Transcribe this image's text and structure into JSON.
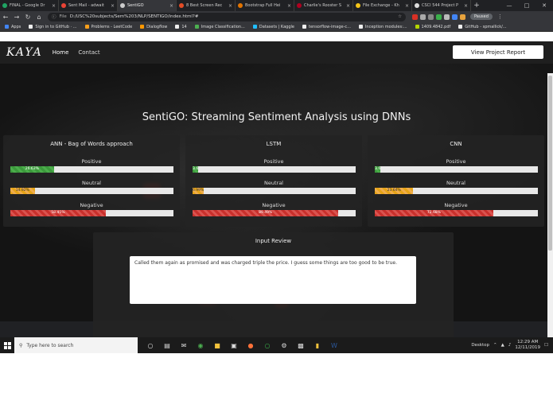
{
  "browser": {
    "tabs": [
      {
        "title": "FINAL - Google Dr",
        "color": "#1fa463"
      },
      {
        "title": "Sent Mail - adwait",
        "color": "#ea4335"
      },
      {
        "title": "SentiGO",
        "color": "#cccccc",
        "active": true
      },
      {
        "title": "8 Best Screen Rec",
        "color": "#e34c26"
      },
      {
        "title": "Bootstrap Full Hei",
        "color": "#e37400"
      },
      {
        "title": "Charlie's Rooster S",
        "color": "#b00020"
      },
      {
        "title": "File Exchange - Kh",
        "color": "#f5c518"
      },
      {
        "title": "CSCI 544 Project P",
        "color": "#dddddd"
      }
    ],
    "url": "D:/USC%20subjects/Sem%203/NLP/SENTIGO/index.html?#",
    "url_prefix": "File",
    "profile_label": "Paused",
    "bookmarks": [
      {
        "label": "Apps",
        "color": "#4285f4"
      },
      {
        "label": "Sign in to GitHub · ...",
        "color": "#eeeeee"
      },
      {
        "label": "Problems - LeetCode",
        "color": "#f89f1b"
      },
      {
        "label": "Dialogflow",
        "color": "#ff9800"
      },
      {
        "label": "14",
        "color": "#eeeeee"
      },
      {
        "label": "Image Classification...",
        "color": "#4caf50"
      },
      {
        "label": "Datasets | Kaggle",
        "color": "#20beff"
      },
      {
        "label": "tensorflow-image-c...",
        "color": "#eeeeee"
      },
      {
        "label": "Inception modules:...",
        "color": "#eeeeee"
      },
      {
        "label": "1409.4842.pdf",
        "color": "#b3d400"
      },
      {
        "label": "GitHub - spmallick/...",
        "color": "#eeeeee"
      }
    ]
  },
  "navbar": {
    "brand": "KAYA",
    "links": [
      "Home",
      "Contact"
    ],
    "report_button": "View Project Report"
  },
  "page_title": "SentiGO: Streaming Sentiment Analysis using DNNs",
  "models": [
    {
      "title": "ANN - Bag of Words approach",
      "bars": [
        {
          "label": "Positive",
          "value": 26.63,
          "text": "26.63%",
          "kind": "green"
        },
        {
          "label": "Neutral",
          "value": 14.92,
          "text": "14.92%",
          "kind": "yellow"
        },
        {
          "label": "Negative",
          "value": 58.45,
          "text": "58.45%",
          "kind": "red"
        }
      ]
    },
    {
      "title": "LSTM",
      "bars": [
        {
          "label": "Positive",
          "value": 3.6,
          "text": "3.6",
          "kind": "green"
        },
        {
          "label": "Neutral",
          "value": 6.99,
          "text": "6.99%",
          "kind": "yellow"
        },
        {
          "label": "Negative",
          "value": 89.49,
          "text": "89.49%",
          "kind": "red"
        }
      ]
    },
    {
      "title": "CNN",
      "bars": [
        {
          "label": "Positive",
          "value": 3.6,
          "text": "3.6",
          "kind": "green"
        },
        {
          "label": "Neutral",
          "value": 23.64,
          "text": "23.64%",
          "kind": "yellow"
        },
        {
          "label": "Negative",
          "value": 72.68,
          "text": "72.68%",
          "kind": "red"
        }
      ]
    }
  ],
  "review": {
    "title": "Input Review",
    "text": "Called them again as promised and was charged triple the price. I guess some things are too good to be true."
  },
  "taskbar": {
    "search_placeholder": "Type here to search",
    "desktop_label": "Desktop",
    "time": "12:29 AM",
    "date": "12/11/2019"
  }
}
